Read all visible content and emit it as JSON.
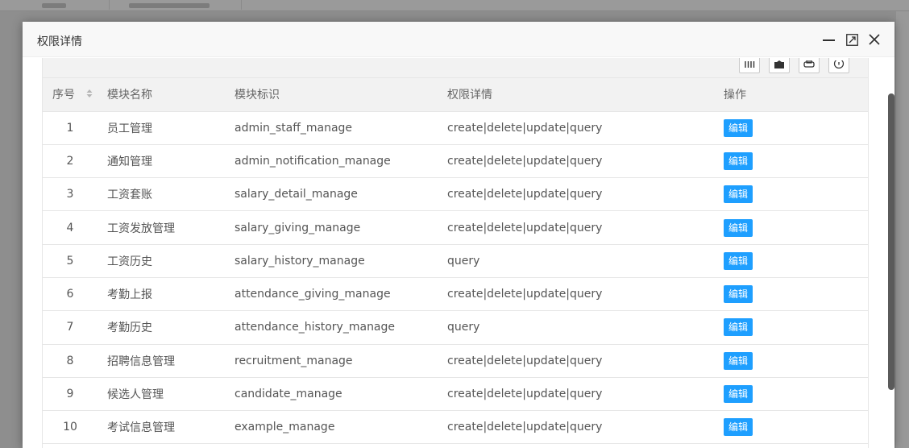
{
  "modal": {
    "title": "权限详情"
  },
  "table": {
    "headers": {
      "no": "序号",
      "name": "模块名称",
      "mark": "模块标识",
      "perm": "权限详情",
      "op": "操作"
    },
    "edit_label": "编辑",
    "rows": [
      {
        "no": "1",
        "name": "员工管理",
        "mark": "admin_staff_manage",
        "perm": "create|delete|update|query"
      },
      {
        "no": "2",
        "name": "通知管理",
        "mark": "admin_notification_manage",
        "perm": "create|delete|update|query"
      },
      {
        "no": "3",
        "name": "工资套账",
        "mark": "salary_detail_manage",
        "perm": "create|delete|update|query"
      },
      {
        "no": "4",
        "name": "工资发放管理",
        "mark": "salary_giving_manage",
        "perm": "create|delete|update|query"
      },
      {
        "no": "5",
        "name": "工资历史",
        "mark": "salary_history_manage",
        "perm": "query"
      },
      {
        "no": "6",
        "name": "考勤上报",
        "mark": "attendance_giving_manage",
        "perm": "create|delete|update|query"
      },
      {
        "no": "7",
        "name": "考勤历史",
        "mark": "attendance_history_manage",
        "perm": "query"
      },
      {
        "no": "8",
        "name": "招聘信息管理",
        "mark": "recruitment_manage",
        "perm": "create|delete|update|query"
      },
      {
        "no": "9",
        "name": "候选人管理",
        "mark": "candidate_manage",
        "perm": "create|delete|update|query"
      },
      {
        "no": "10",
        "name": "考试信息管理",
        "mark": "example_manage",
        "perm": "create|delete|update|query"
      }
    ]
  },
  "toolbar": {
    "icons": [
      "columns-icon",
      "export-icon",
      "print-icon",
      "info-icon"
    ]
  },
  "window_controls": [
    "minimize-icon",
    "maximize-icon",
    "close-icon"
  ],
  "colors": {
    "edit_button": "#1e9fff",
    "header_bg": "#f2f2f2"
  }
}
